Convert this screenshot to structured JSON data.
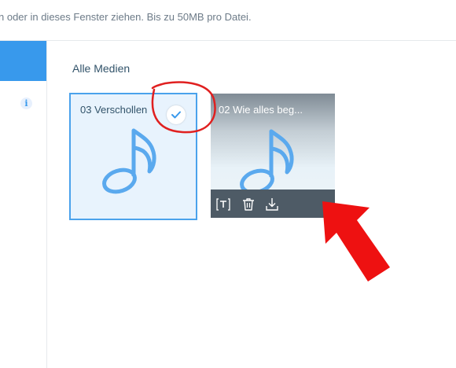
{
  "upload_hint": "n oder in dieses Fenster ziehen. Bis zu 50MB pro Datei.",
  "sidebar": {
    "info_icon_glyph": "i"
  },
  "gallery": {
    "section_title": "Alle Medien",
    "items": [
      {
        "name": "03 Verschollen",
        "selected": true,
        "icon": "music-note-icon"
      },
      {
        "name": "02 Wie alles beg...",
        "selected": false,
        "hovered": true,
        "icon": "music-note-icon",
        "actions": [
          "text-edit-icon",
          "trash-icon",
          "download-icon"
        ]
      }
    ]
  },
  "colors": {
    "accent": "#3899ec",
    "tile_selected_bg": "#e8f3fd",
    "note": "#5aa9ee",
    "action_bar": "#4e5b66",
    "annotation": "#e02020"
  }
}
